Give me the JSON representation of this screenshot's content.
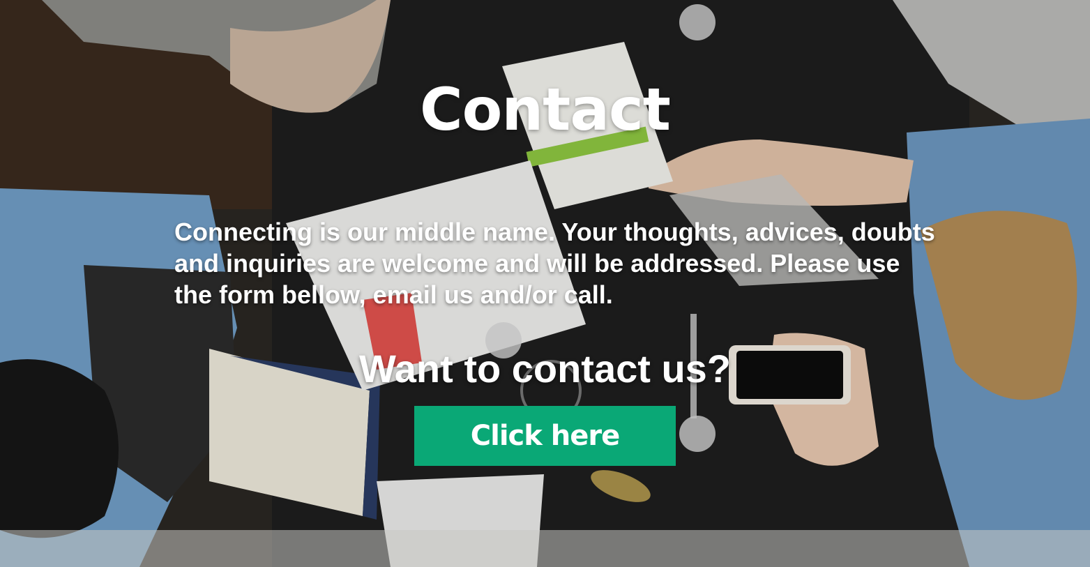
{
  "hero": {
    "title": "Contact",
    "intro": "Connecting is our middle name. Your thoughts, advices, doubts and inquiries are welcome and will be addressed. Please use the form bellow, email us and/or call.",
    "subheading": "Want to contact us?",
    "cta_label": "Click here"
  },
  "background": {
    "description_icon": "overhead-photo-people-at-table-icon",
    "colors": {
      "table": "#1f1f1f",
      "denim": "#6f9cc4",
      "paper": "#e9e9e6",
      "button": "#0aa876"
    }
  }
}
